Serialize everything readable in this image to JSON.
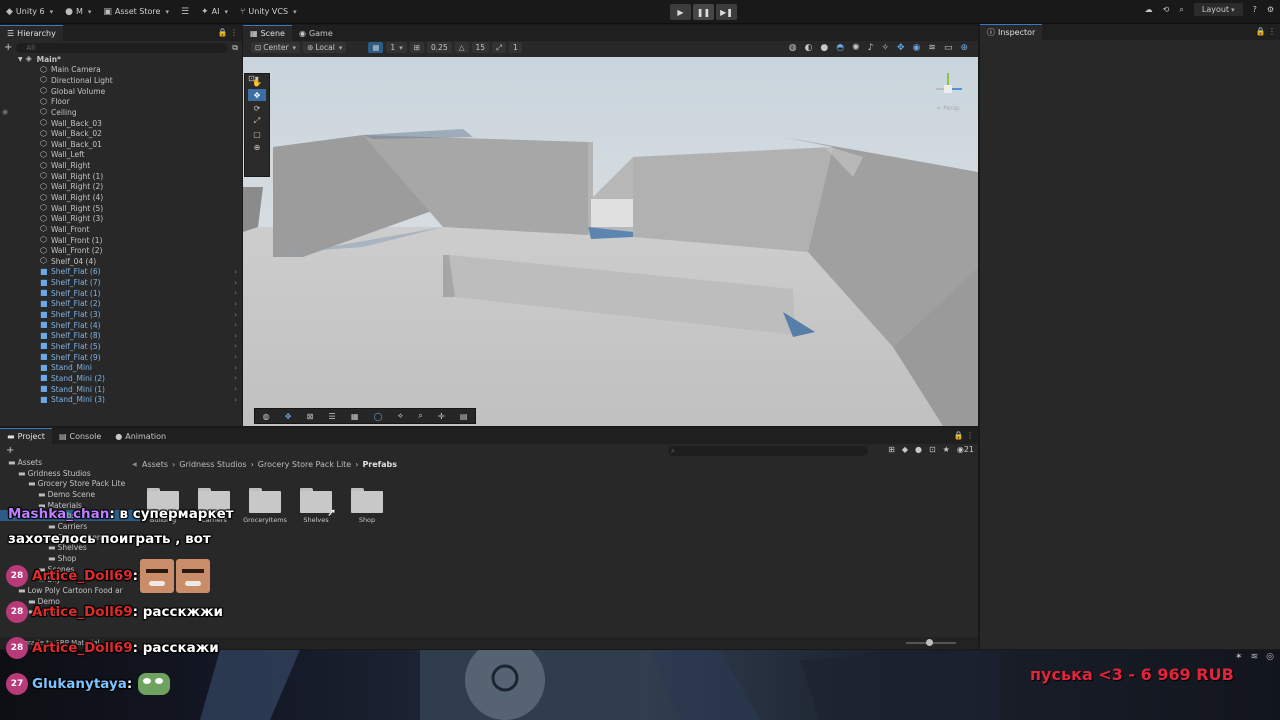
{
  "topbar": {
    "account": "Unity 6",
    "user": "M",
    "asset_store": "Asset Store",
    "ai": "AI",
    "vcs": "Unity VCS",
    "layout": "Layout"
  },
  "hierarchy": {
    "tab": "Hierarchy",
    "search_placeholder": "All",
    "scene_name": "Main*",
    "items": [
      {
        "name": "Main Camera",
        "prefab": false
      },
      {
        "name": "Directional Light",
        "prefab": false
      },
      {
        "name": "Global Volume",
        "prefab": false
      },
      {
        "name": "Floor",
        "prefab": false
      },
      {
        "name": "Ceiling",
        "prefab": false
      },
      {
        "name": "Wall_Back_03",
        "prefab": false
      },
      {
        "name": "Wall_Back_02",
        "prefab": false
      },
      {
        "name": "Wall_Back_01",
        "prefab": false
      },
      {
        "name": "Wall_Left",
        "prefab": false
      },
      {
        "name": "Wall_Right",
        "prefab": false
      },
      {
        "name": "Wall_Right (1)",
        "prefab": false
      },
      {
        "name": "Wall_Right (2)",
        "prefab": false
      },
      {
        "name": "Wall_Right (4)",
        "prefab": false
      },
      {
        "name": "Wall_Right (5)",
        "prefab": false
      },
      {
        "name": "Wall_Right (3)",
        "prefab": false
      },
      {
        "name": "Wall_Front",
        "prefab": false
      },
      {
        "name": "Wall_Front (1)",
        "prefab": false
      },
      {
        "name": "Wall_Front (2)",
        "prefab": false
      },
      {
        "name": "Shelf_04 (4)",
        "prefab": false
      },
      {
        "name": "Shelf_Flat (6)",
        "prefab": true
      },
      {
        "name": "Shelf_Flat (7)",
        "prefab": true
      },
      {
        "name": "Shelf_Flat (1)",
        "prefab": true
      },
      {
        "name": "Shelf_Flat (2)",
        "prefab": true
      },
      {
        "name": "Shelf_Flat (3)",
        "prefab": true
      },
      {
        "name": "Shelf_Flat (4)",
        "prefab": true
      },
      {
        "name": "Shelf_Flat (8)",
        "prefab": true
      },
      {
        "name": "Shelf_Flat (5)",
        "prefab": true
      },
      {
        "name": "Shelf_Flat (9)",
        "prefab": true
      },
      {
        "name": "Stand_Mini",
        "prefab": true
      },
      {
        "name": "Stand_Mini (2)",
        "prefab": true
      },
      {
        "name": "Stand_Mini (1)",
        "prefab": true
      },
      {
        "name": "Stand_Mini (3)",
        "prefab": true
      }
    ]
  },
  "scene": {
    "tabs": [
      "Scene",
      "Game"
    ],
    "pivot": "Center",
    "space": "Local",
    "grid_value": "1",
    "snap_value": "0.25",
    "rotate_snap": "15",
    "scale_snap": "1",
    "persp_label": "< Persp"
  },
  "inspector": {
    "tab": "Inspector"
  },
  "project": {
    "tabs": [
      "Project",
      "Console",
      "Animation"
    ],
    "count": "21",
    "breadcrumb": [
      "Assets",
      "Gridness Studios",
      "Grocery Store Pack Lite",
      "Prefabs"
    ],
    "tree": [
      {
        "label": "Assets",
        "indent": 0,
        "sel": false
      },
      {
        "label": "Gridness Studios",
        "indent": 1,
        "sel": false
      },
      {
        "label": "Grocery Store Pack Lite",
        "indent": 2,
        "sel": false
      },
      {
        "label": "Demo Scene",
        "indent": 3,
        "sel": false
      },
      {
        "label": "Materials",
        "indent": 3,
        "sel": false
      },
      {
        "label": "Prefabs",
        "indent": 3,
        "sel": true
      },
      {
        "label": "Carriers",
        "indent": 4,
        "sel": false
      },
      {
        "label": "GroceryItems",
        "indent": 4,
        "sel": false
      },
      {
        "label": "Shelves",
        "indent": 4,
        "sel": false
      },
      {
        "label": "Shop",
        "indent": 4,
        "sel": false
      },
      {
        "label": "Scenes",
        "indent": 3,
        "sel": false
      },
      {
        "label": "Sky",
        "indent": 3,
        "sel": false
      },
      {
        "label": "Low Poly Cartoon Food ar",
        "indent": 1,
        "sel": false
      },
      {
        "label": "Demo",
        "indent": 2,
        "sel": false
      },
      {
        "label": "Lemon",
        "indent": 2,
        "sel": false
      }
    ],
    "folders": [
      "Building",
      "Carriers",
      "GroceryItems",
      "Shelves",
      "Shop"
    ],
    "status": "Upgrade to SRP Material"
  },
  "chat": [
    {
      "user": "Mashka_chan",
      "msg": ": в супермаркет",
      "msg2": "захотелось поиграть , вот",
      "badge": ""
    },
    {
      "user": "Artice_Doll69",
      "msg": ":",
      "badge": "28",
      "emote": true
    },
    {
      "user": "Artice_Doll69",
      "msg": ": расскжжи",
      "badge": "28"
    },
    {
      "user": "Artice_Doll69",
      "msg": ": расскажи",
      "badge": "28"
    },
    {
      "user": "Glukanytaya",
      "msg": ":",
      "badge": "27",
      "pepe": true
    }
  ],
  "donation": "пуська <3 - 6 969 RUB",
  "colors": {
    "accent": "#3a79bb",
    "prefab_text": "#7fb4e6",
    "selection": "#2c5d87",
    "chat_red": "#e02b2b",
    "chat_purple": "#c07fff",
    "chat_blue": "#7ec3ff",
    "donation_red": "#e3243a"
  }
}
